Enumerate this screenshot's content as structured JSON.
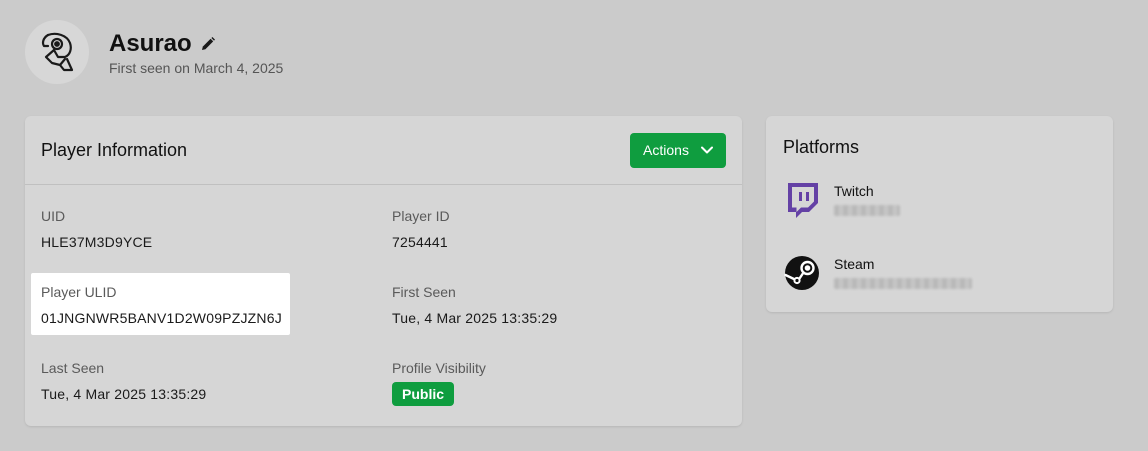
{
  "profile": {
    "name": "Asurao",
    "first_seen_text": "First seen on March 4, 2025"
  },
  "player_info": {
    "title": "Player Information",
    "actions_label": "Actions",
    "fields": {
      "uid": {
        "label": "UID",
        "value": "HLE37M3D9YCE"
      },
      "player_id": {
        "label": "Player ID",
        "value": "7254441"
      },
      "player_ulid": {
        "label": "Player ULID",
        "value": "01JNGNWR5BANV1D2W09PZJZN6J"
      },
      "first_seen": {
        "label": "First Seen",
        "value": "Tue, 4 Mar 2025 13:35:29"
      },
      "last_seen": {
        "label": "Last Seen",
        "value": "Tue, 4 Mar 2025 13:35:29"
      },
      "visibility": {
        "label": "Profile Visibility",
        "value": "Public"
      }
    }
  },
  "platforms": {
    "title": "Platforms",
    "items": [
      {
        "name": "Twitch",
        "icon": "twitch-icon"
      },
      {
        "name": "Steam",
        "icon": "steam-icon"
      }
    ]
  },
  "colors": {
    "background": "#cbcbcb",
    "card": "#d6d6d6",
    "accent_green": "#0f9d3f",
    "twitch_purple": "#6441a5"
  }
}
